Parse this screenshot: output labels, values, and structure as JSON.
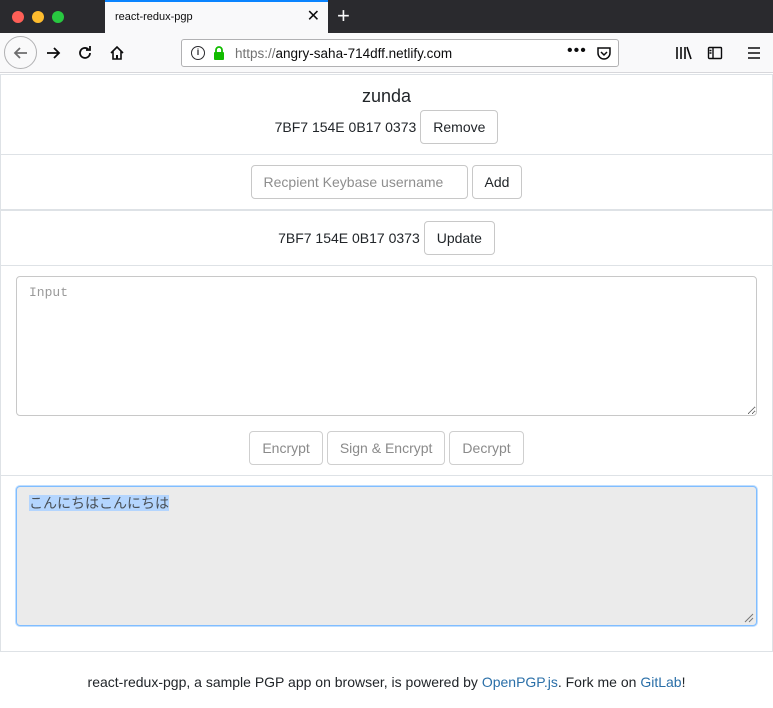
{
  "browser": {
    "tab_title": "react-redux-pgp",
    "tab_close": "✕",
    "new_tab": "+",
    "url_scheme": "https://",
    "url_host": "angry-saha-714dff.netlify.com",
    "url_more": "•••"
  },
  "recipient": {
    "name": "zunda",
    "fingerprint": "7BF7 154E 0B17 0373",
    "remove_label": "Remove"
  },
  "add_recipient": {
    "placeholder": "Recpient Keybase username",
    "value": "",
    "add_label": "Add"
  },
  "own_key": {
    "fingerprint": "7BF7 154E 0B17 0373",
    "update_label": "Update"
  },
  "input": {
    "placeholder": "Input",
    "value": ""
  },
  "actions": {
    "encrypt_label": "Encrypt",
    "sign_encrypt_label": "Sign & Encrypt",
    "decrypt_label": "Decrypt"
  },
  "output": {
    "text": "こんにちはこんにちは"
  },
  "footer": {
    "text_before": "react-redux-pgp, a sample PGP app on browser, is powered by ",
    "openpgp_link": "OpenPGP.js",
    "text_middle": ". Fork me on ",
    "gitlab_link": "GitLab",
    "text_after": "!"
  },
  "colors": {
    "link": "#2a6fa8",
    "focus_border": "#80bdff",
    "selection": "#b4d5fe",
    "tab_accent": "#0a84ff"
  }
}
